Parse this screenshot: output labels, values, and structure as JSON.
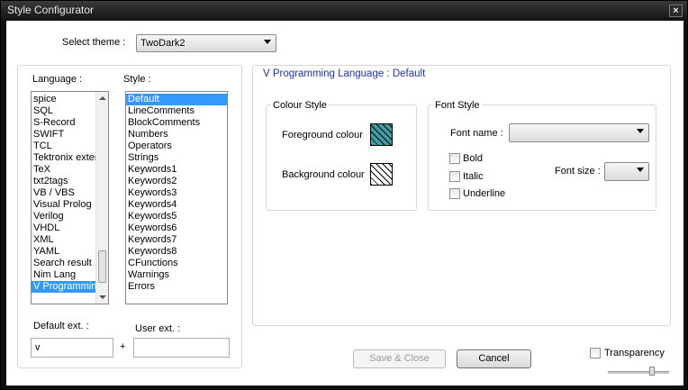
{
  "window": {
    "title": "Style Configurator"
  },
  "theme": {
    "label": "Select theme :",
    "selected": "TwoDark2"
  },
  "language": {
    "label": "Language :",
    "items": [
      "spice",
      "SQL",
      "S-Record",
      "SWIFT",
      "TCL",
      "Tektronix extended HEX",
      "TeX",
      "txt2tags",
      "VB / VBS",
      "Visual Prolog",
      "Verilog",
      "VHDL",
      "XML",
      "YAML",
      "Search result",
      "Nim Lang",
      "V Programming Language"
    ],
    "selected_index": 16
  },
  "style": {
    "label": "Style :",
    "items": [
      "Default",
      "LineComments",
      "BlockComments",
      "Numbers",
      "Operators",
      "Strings",
      "Keywords1",
      "Keywords2",
      "Keywords3",
      "Keywords4",
      "Keywords5",
      "Keywords6",
      "Keywords7",
      "Keywords8",
      "CFunctions",
      "Warnings",
      "Errors"
    ],
    "selected_index": 0
  },
  "ext": {
    "default_label": "Default ext. :",
    "default_value": "v",
    "plus": "+",
    "user_label": "User ext. :",
    "user_value": ""
  },
  "panel": {
    "heading": "V Programming Language : Default"
  },
  "colour_style": {
    "title": "Colour Style",
    "foreground_label": "Foreground colour",
    "background_label": "Background colour",
    "foreground_color": "#3d9ea6",
    "background_color": "#ffffff"
  },
  "font_style": {
    "title": "Font Style",
    "font_name_label": "Font name :",
    "font_name_value": "",
    "bold_label": "Bold",
    "italic_label": "Italic",
    "underline_label": "Underline",
    "font_size_label": "Font size :",
    "font_size_value": ""
  },
  "buttons": {
    "save_close": "Save & Close",
    "cancel": "Cancel"
  },
  "transparency": {
    "label": "Transparency"
  }
}
